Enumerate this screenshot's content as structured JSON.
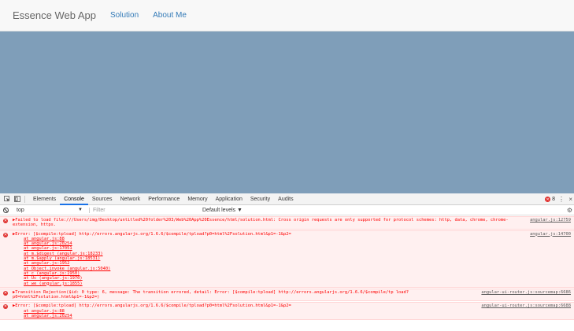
{
  "app": {
    "brand": "Essence Web App",
    "nav": [
      "Solution",
      "About Me"
    ]
  },
  "devtools": {
    "tabs": [
      "Elements",
      "Console",
      "Sources",
      "Network",
      "Performance",
      "Memory",
      "Application",
      "Security",
      "Audits"
    ],
    "error_count": "8",
    "context": "top",
    "filter_placeholder": "Filter",
    "levels": "Default levels ▼"
  },
  "messages": [
    {
      "text": "▶Failed to load file:///Users/img/Desktop/untitled%20folder%203/Web%20App%20Essence/html/solution.html: Cross origin requests are only supported for protocol schemes: http, data, chrome, chrome-extension, https.",
      "source": "angular.js:12759"
    },
    {
      "text": "▶Error: [$compile:tpload] http://errors.angularjs.org/1.6.6/$compile/tpload?p0=html%2Fsolution.html&p1=-1&p2=",
      "source": "angular.js:14700",
      "stack": [
        "at angular.js:88",
        "at angular.js:20254",
        "at angular.js:17051",
        "at m.$digest (angular.js:18233)",
        "at m.$apply (angular.js:18531)",
        "at angular.js:1952",
        "at Object.invoke (angular.js:5040)",
        "at c (angular.js:1950)",
        "at Uc (angular.js:1970)",
        "at we (angular.js:1855)"
      ]
    },
    {
      "text": "▶Transition Rejection($id: 0 type: 6, message: The transition errored, detail: Error: [$compile:tpload] http://errors.angularjs.org/1.6.6/$compile/tp load?p0=html%2Fsolution.html&p1=-1&p2=)",
      "source": "angular-ui-router.js:sourcemap:6686"
    },
    {
      "text": "▶Error: [$compile:tpload] http://errors.angularjs.org/1.6.6/$compile/tpload?p0=html%2Fsolution.html&p1=-1&p2=",
      "source": "angular-ui-router.js:sourcemap:6688",
      "stack": [
        "at angular.js:88",
        "at angular.js:20254"
      ]
    }
  ]
}
